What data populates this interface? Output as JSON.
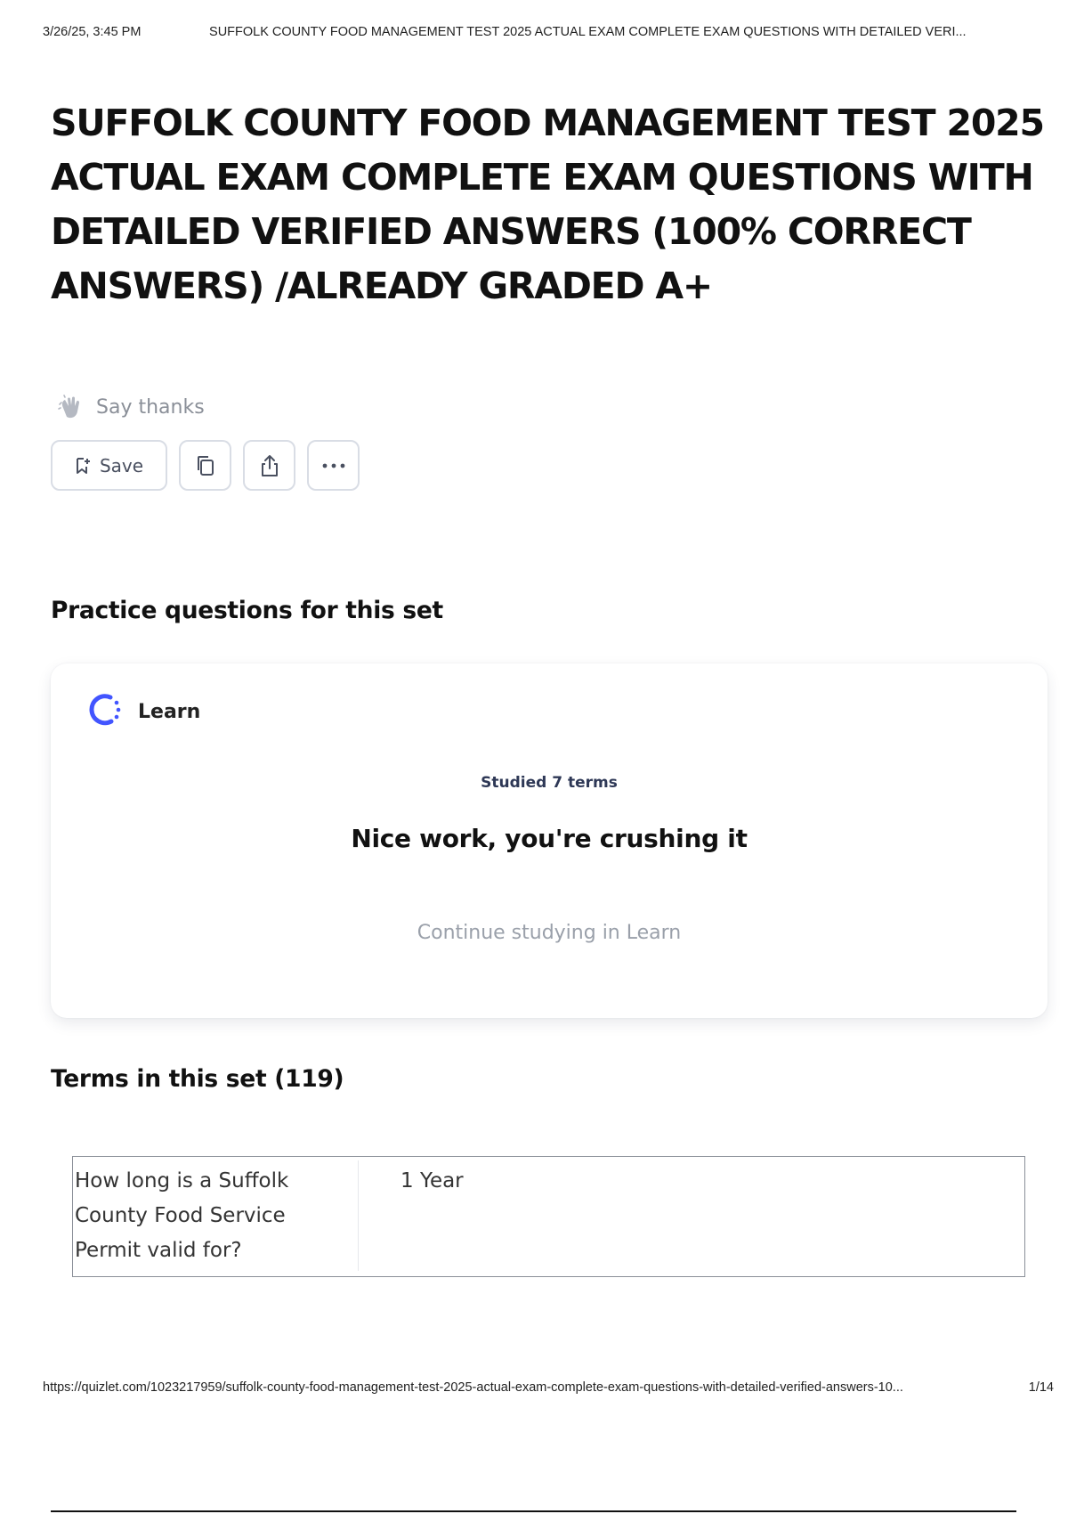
{
  "print_header": {
    "date": "3/26/25, 3:45 PM",
    "doc_title": "SUFFOLK COUNTY FOOD MANAGEMENT TEST 2025 ACTUAL EXAM COMPLETE EXAM QUESTIONS WITH DETAILED VERI..."
  },
  "set": {
    "title": "SUFFOLK COUNTY FOOD MANAGEMENT TEST 2025 ACTUAL EXAM COMPLETE EXAM QUESTIONS WITH DETAILED VERIFIED ANSWERS (100% CORRECT ANSWERS)  /ALREADY GRADED A+",
    "say_thanks": "Say thanks"
  },
  "toolbar": {
    "save_label": "Save",
    "icons": [
      "bookmark-add-icon",
      "copy-icon",
      "share-icon",
      "more-icon"
    ]
  },
  "practice": {
    "heading": "Practice questions for this set",
    "learn_label": "Learn",
    "studied": "Studied 7 terms",
    "message": "Nice work, you're crushing it",
    "continue": "Continue studying in Learn"
  },
  "terms": {
    "heading": "Terms in this set (119)",
    "items": [
      {
        "term": "How long is a Suffolk County Food Service Permit valid for?",
        "definition": "1 Year"
      }
    ]
  },
  "print_footer": {
    "url": "https://quizlet.com/1023217959/suffolk-county-food-management-test-2025-actual-exam-complete-exam-questions-with-detailed-verified-answers-10...",
    "page": "1/14"
  },
  "colors": {
    "accent": "#4255ff",
    "muted_text": "#8a8f98",
    "border": "#d9dde5"
  }
}
